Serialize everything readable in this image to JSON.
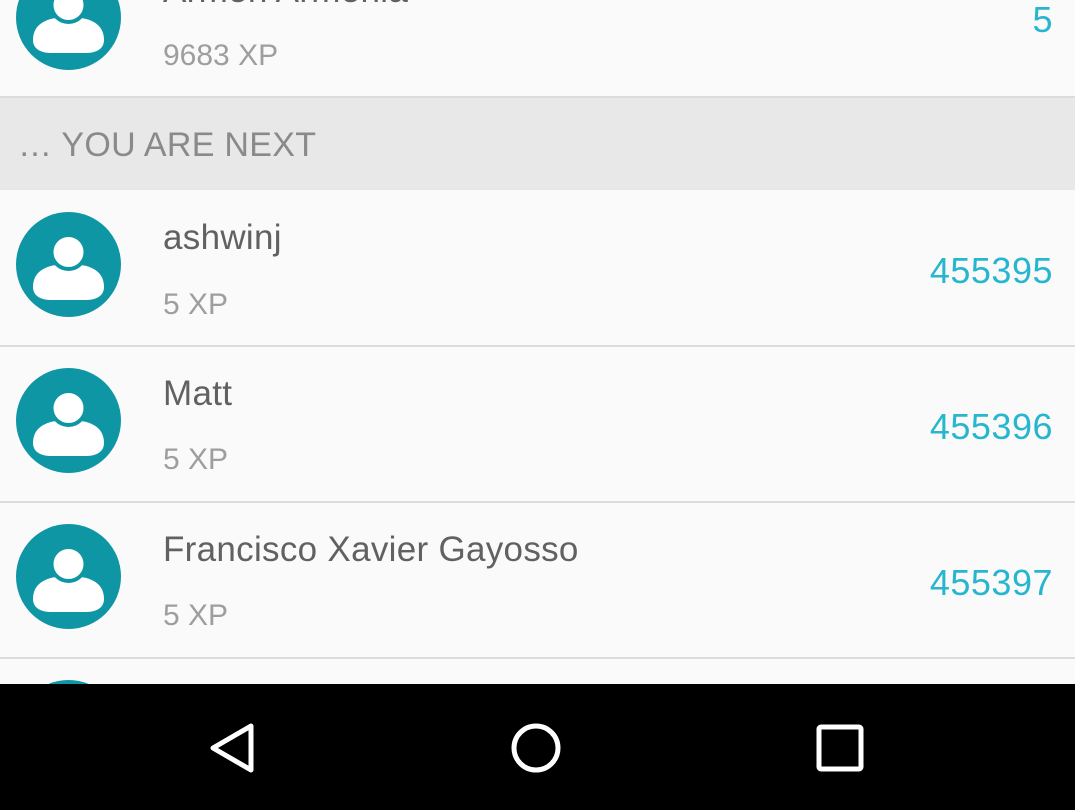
{
  "top_entry": {
    "name": "Armen Armenia",
    "xp": "9683 XP",
    "rank": "5"
  },
  "section_header": "… YOU ARE NEXT",
  "entries": [
    {
      "name": "ashwinj",
      "xp": "5 XP",
      "rank": "455395"
    },
    {
      "name": "Matt",
      "xp": "5 XP",
      "rank": "455396"
    },
    {
      "name": "Francisco Xavier Gayosso",
      "xp": "5 XP",
      "rank": "455397"
    }
  ],
  "icons": {
    "avatar": "user-avatar-icon",
    "back": "back-triangle-icon",
    "home": "home-circle-icon",
    "recents": "recents-square-icon"
  },
  "colors": {
    "accent": "#26b6cf",
    "avatar": "#0e96a4",
    "name": "#616161",
    "xp": "#9e9e9e",
    "section_bg": "#e8e8e8",
    "navbar": "#000000"
  }
}
